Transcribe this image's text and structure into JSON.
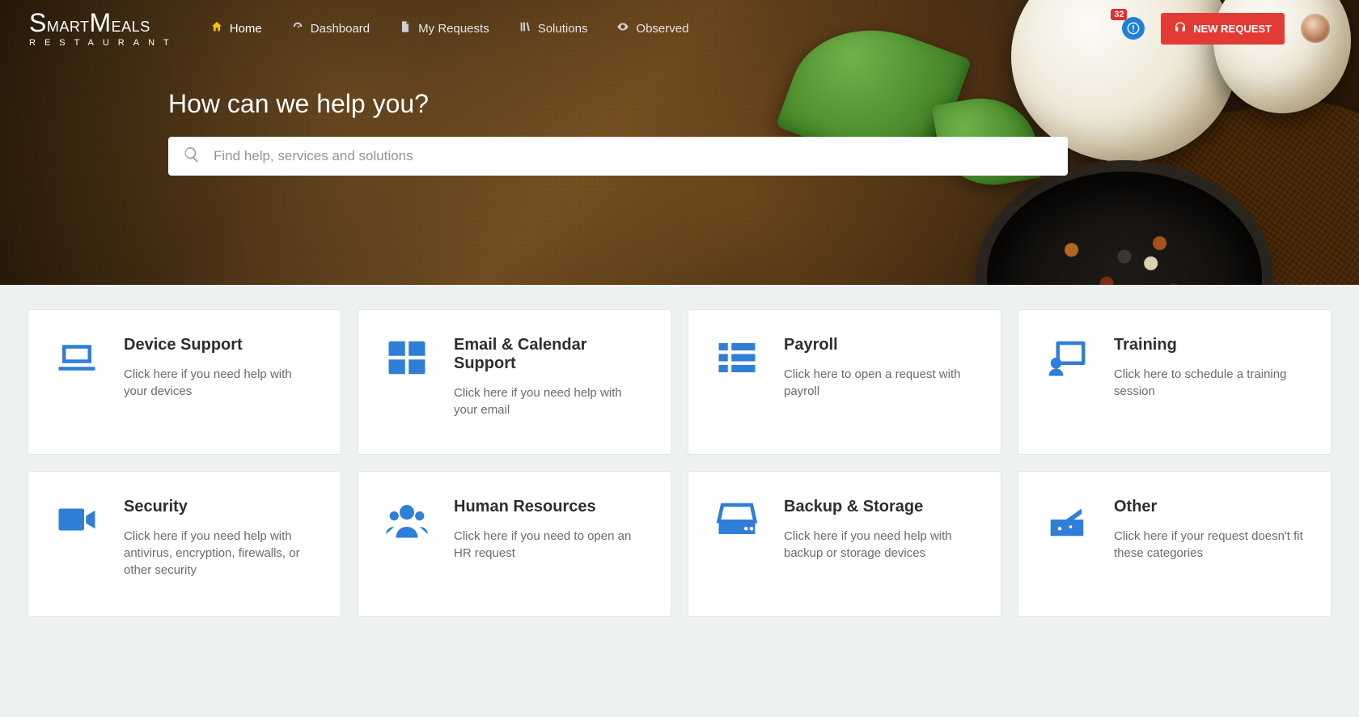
{
  "brand": {
    "name_top": "SmartMeals",
    "name_sub": "RESTAURANT"
  },
  "nav": {
    "items": [
      {
        "label": "Home"
      },
      {
        "label": "Dashboard"
      },
      {
        "label": "My Requests"
      },
      {
        "label": "Solutions"
      },
      {
        "label": "Observed"
      }
    ]
  },
  "header": {
    "new_request_label": "NEW REQUEST",
    "notif_count": "32"
  },
  "hero": {
    "title": "How can we help you?",
    "search_placeholder": "Find help, services and solutions"
  },
  "cards": [
    {
      "title": "Device Support",
      "desc": "Click here if you need help with your devices"
    },
    {
      "title": "Email & Calendar Support",
      "desc": "Click here if you need help with your email"
    },
    {
      "title": "Payroll",
      "desc": "Click here to open a request with payroll"
    },
    {
      "title": "Training",
      "desc": "Click here to schedule a train­ing session"
    },
    {
      "title": "Security",
      "desc": "Click here if you need help with antivirus, encryption, firewalls, or other security"
    },
    {
      "title": "Human Resources",
      "desc": "Click here if you need to open an HR request"
    },
    {
      "title": "Backup & Storage",
      "desc": "Click here if you need help with backup or storage devices"
    },
    {
      "title": "Other",
      "desc": "Click here if your request doesn't fit these categories"
    }
  ]
}
